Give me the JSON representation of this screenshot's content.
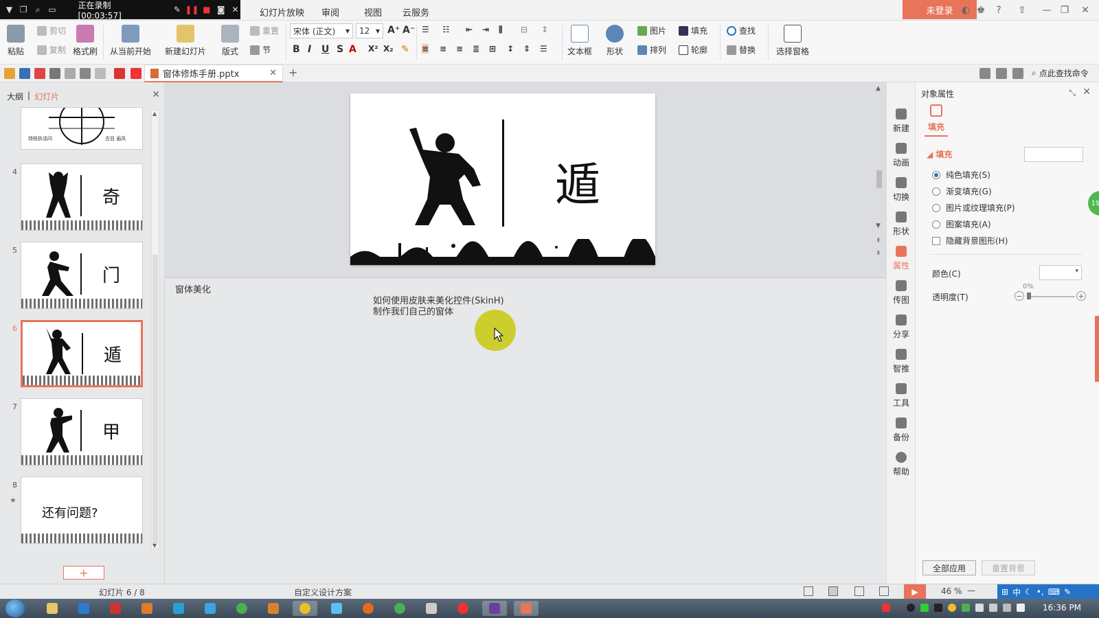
{
  "titlebar": {
    "recording_status": "正在录制 [00:03:57]",
    "menu_tabs": [
      "幻灯片放映",
      "审阅",
      "视图",
      "云服务"
    ],
    "login_label": "未登录",
    "help_label": "?"
  },
  "ribbon": {
    "paste": "粘贴",
    "cut": "剪切",
    "copy": "复制",
    "format_painter": "格式刷",
    "from_current": "从当前开始",
    "new_slide": "新建幻灯片",
    "layout": "版式",
    "reset": "重置",
    "section": "节",
    "font_name": "宋体 (正文)",
    "font_size": "12",
    "bold": "B",
    "italic": "I",
    "underline": "U",
    "strike": "S",
    "font_color": "A",
    "superscript": "X²",
    "subscript": "X₂",
    "textbox": "文本框",
    "shape": "形状",
    "picture": "图片",
    "fill": "填充",
    "arrange": "排列",
    "outline": "轮廓",
    "find": "查找",
    "replace": "替换",
    "select_pane": "选择窗格"
  },
  "quickbar": {
    "doc_tab": "窗体修炼手册.pptx",
    "find_command": "点此查找命令"
  },
  "left_panel": {
    "tab_outline": "大纲",
    "tab_slides": "幻灯片",
    "slides": [
      {
        "num": "",
        "char": ""
      },
      {
        "num": "4",
        "char": "奇"
      },
      {
        "num": "5",
        "char": "门"
      },
      {
        "num": "6",
        "char": "遁"
      },
      {
        "num": "7",
        "char": "甲"
      },
      {
        "num": "8",
        "char": "还有问题?"
      }
    ],
    "thumb_caption_left": "持枝执话问",
    "thumb_caption_right": "古目 画风"
  },
  "slide": {
    "char": "遁"
  },
  "notes": {
    "title": "窗体美化",
    "line1": "如何使用皮肤来美化控件(SkinH)",
    "line2": "制作我们自己的窗体"
  },
  "iconbar": [
    "新建",
    "动画",
    "切换",
    "形状",
    "属性",
    "传图",
    "分享",
    "智推",
    "工具",
    "备份",
    "帮助"
  ],
  "properties": {
    "title": "对象属性",
    "tab_fill": "填充",
    "section_fill": "填充",
    "options": [
      {
        "label": "纯色填充(S)",
        "checked": true
      },
      {
        "label": "渐变填充(G)",
        "checked": false
      },
      {
        "label": "图片或纹理填充(P)",
        "checked": false
      },
      {
        "label": "图案填充(A)",
        "checked": false
      }
    ],
    "hide_bg": "隐藏背景图形(H)",
    "color_label": "颜色(C)",
    "transparency_label": "透明度(T)",
    "transparency_value": "0%",
    "apply_all": "全部应用",
    "reset_bg": "重置背景",
    "side_badge": "19"
  },
  "status": {
    "slide_count": "幻灯片 6 / 8",
    "design": "自定义设计方案",
    "zoom": "46 %",
    "ime": "中"
  },
  "taskbar": {
    "clock": "16:36 PM"
  },
  "colors": {
    "accent": "#e8745a",
    "cursor_highlight": "#c9cb1a",
    "ime_blue": "#2573c6"
  }
}
